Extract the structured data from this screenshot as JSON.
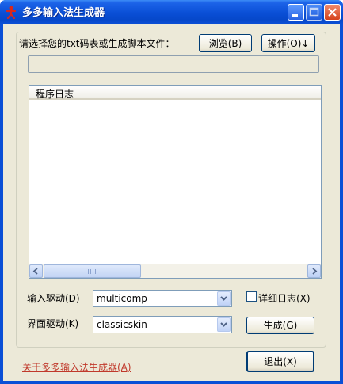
{
  "window": {
    "title": "多多输入法生成器",
    "icon": "red-stick-figure-icon"
  },
  "controls": {
    "file_prompt": "请选择您的txt码表或生成脚本文件：",
    "browse_label": "浏览(B)",
    "operate_label": "操作(O)↓",
    "log_header": "程序日志",
    "scroll_grip": "|||",
    "input_driver_label": "输入驱动(D)",
    "input_driver_value": "multicomp",
    "detail_log_label": "详细日志(X)",
    "detail_log_checked": false,
    "ui_driver_label": "界面驱动(K)",
    "ui_driver_value": "classicskin",
    "generate_label": "生成(G)",
    "about_link": "关于多多输入法生成器(A)",
    "exit_label": "退出(X)"
  },
  "colors": {
    "titlebar": "#0a4fd6",
    "dialog_bg": "#ece9d8",
    "link": "#c0392b"
  }
}
